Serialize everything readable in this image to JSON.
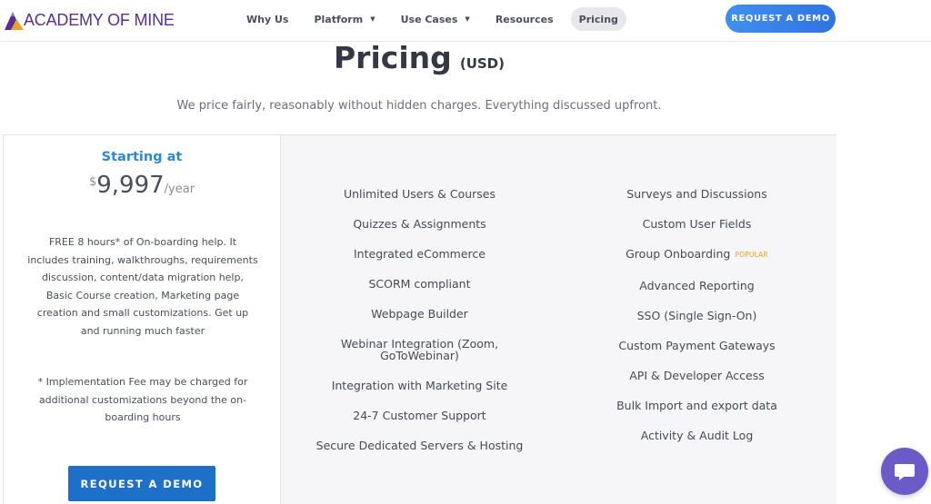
{
  "brand": {
    "name": "ACADEMY OF MINE",
    "primary_color": "#5b2d8e",
    "accent_color": "#2a8ad8"
  },
  "nav": {
    "links": [
      {
        "label": "Why Us",
        "dropdown": false
      },
      {
        "label": "Platform",
        "dropdown": true
      },
      {
        "label": "Use Cases",
        "dropdown": true
      },
      {
        "label": "Resources",
        "dropdown": false
      },
      {
        "label": "Pricing",
        "dropdown": false,
        "active": true
      }
    ],
    "cta": "REQUEST A DEMO"
  },
  "header": {
    "title": "Pricing",
    "currency": "(USD)",
    "subtitle": "We price fairly, reasonably without hidden charges. Everything discussed upfront."
  },
  "plan": {
    "starting_label": "Starting at",
    "currency_symbol": "$",
    "price": "9,997",
    "period": "/year",
    "description": "FREE 8 hours* of On-boarding help. It includes training, walkthroughs, requirements discussion, content/data migration help, Basic Course creation, Marketing page creation and small customizations. Get up and running much faster",
    "footnote": "* Implementation Fee may be charged for additional customizations beyond the on-boarding hours",
    "cta": "REQUEST A DEMO"
  },
  "features": {
    "column1": [
      "Unlimited Users & Courses",
      "Quizzes & Assignments",
      "Integrated eCommerce",
      "SCORM compliant",
      "Webpage Builder",
      "Webinar Integration (Zoom, GoToWebinar)",
      "Integration with Marketing Site",
      "24-7 Customer Support",
      "Secure Dedicated Servers & Hosting"
    ],
    "column2": [
      "Surveys and Discussions",
      "Custom User Fields",
      "Group Onboarding",
      "Advanced Reporting",
      "SSO (Single Sign-On)",
      "Custom Payment Gateways",
      "API & Developer Access",
      "Bulk Import and export data",
      "Activity & Audit Log"
    ],
    "popular_badge": "POPULAR"
  },
  "chat": {
    "icon": "chat-bubble-icon"
  }
}
